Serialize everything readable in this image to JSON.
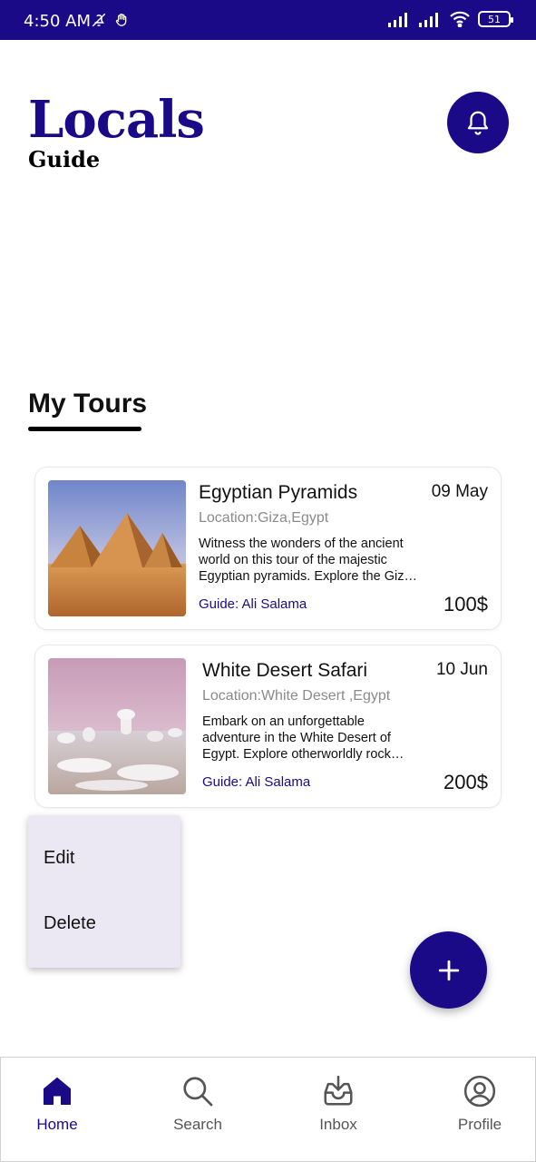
{
  "status_bar": {
    "time": "4:50 AM",
    "battery": "51"
  },
  "header": {
    "logo_title": "Locals",
    "logo_subtitle": "Guide"
  },
  "section": {
    "title": "My Tours"
  },
  "tours": [
    {
      "title": "Egyptian Pyramids",
      "date": "09 May",
      "location": "Location:Giza,Egypt",
      "description": "Witness the wonders of the ancient world on this tour of the majestic Egyptian pyramids. Explore the Giza plateau and its timeless monuments.",
      "guide": "Guide: Ali Salama",
      "price": "100$"
    },
    {
      "title": "White Desert Safari",
      "date": "10 Jun",
      "location": "Location:White Desert ,Egypt",
      "description": "Embark on an unforgettable adventure in the White Desert of Egypt. Explore otherworldly rock formations and chalk landscapes.",
      "guide": "Guide: Ali Salama",
      "price": "200$"
    }
  ],
  "context_menu": {
    "edit": "Edit",
    "delete": "Delete"
  },
  "bottom_nav": [
    {
      "label": "Home",
      "icon": "home-icon",
      "active": true
    },
    {
      "label": "Search",
      "icon": "search-icon",
      "active": false
    },
    {
      "label": "Inbox",
      "icon": "inbox-icon",
      "active": false
    },
    {
      "label": "Profile",
      "icon": "profile-icon",
      "active": false
    }
  ],
  "colors": {
    "primary": "#1a0a87",
    "menu_bg": "#ebe8f4",
    "muted_text": "#8a8a8a"
  }
}
